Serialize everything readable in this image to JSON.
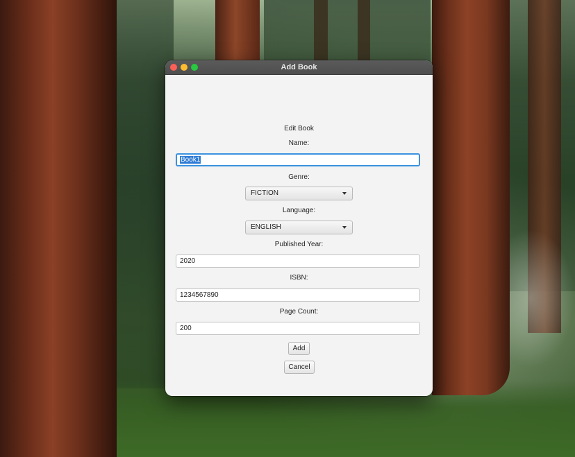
{
  "window": {
    "title": "Add Book"
  },
  "form": {
    "heading": "Edit Book",
    "name_label": "Name:",
    "name_value": "Book1",
    "genre_label": "Genre:",
    "genre_value": "FICTION",
    "language_label": "Language:",
    "language_value": "ENGLISH",
    "year_label": "Published Year:",
    "year_value": "2020",
    "isbn_label": "ISBN:",
    "isbn_value": "1234567890",
    "pages_label": "Page Count:",
    "pages_value": "200"
  },
  "buttons": {
    "add_label": "Add",
    "cancel_label": "Cancel"
  },
  "colors": {
    "focus_ring": "#3a92df",
    "selection": "#2f7bd4",
    "traffic_close": "#fe5f57",
    "traffic_minimize": "#febc2e",
    "traffic_zoom": "#28c840"
  },
  "icons": {
    "combo_arrow": "chevron-down-icon"
  }
}
